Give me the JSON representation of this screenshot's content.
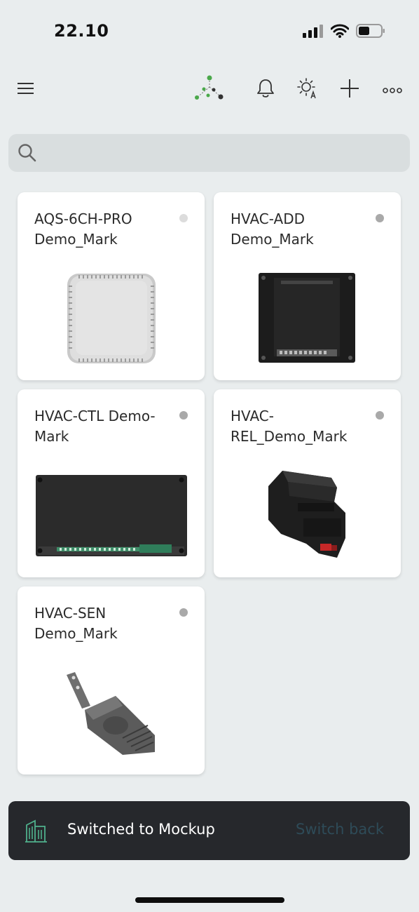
{
  "status_bar": {
    "time": "22.10"
  },
  "toolbar": {
    "icons": [
      "menu-icon",
      "logo-icon",
      "bell-icon",
      "brightness-icon",
      "plus-icon",
      "more-icon"
    ]
  },
  "search": {
    "placeholder": "",
    "value": ""
  },
  "devices": [
    {
      "name": "AQS-6CH-PRO Demo_Mark",
      "status_color": "#d9d9d9",
      "image": "air-quality-sensor"
    },
    {
      "name": "HVAC-ADD Demo_Mark",
      "status_color": "#a9a9a9",
      "image": "din-rail-module-black"
    },
    {
      "name": "HVAC-CTL Demo-Mark",
      "status_color": "#a9a9a9",
      "image": "controller-board"
    },
    {
      "name": "HVAC-REL_Demo_Mark",
      "status_color": "#a9a9a9",
      "image": "din-relay"
    },
    {
      "name": "HVAC-SEN Demo_Mark",
      "status_color": "#a9a9a9",
      "image": "temperature-sensor"
    }
  ],
  "toast": {
    "message": "Switched to Mockup",
    "action": "Switch back"
  },
  "colors": {
    "background": "#e9edee",
    "accent_green": "#4aa84a",
    "toast_bg": "#26282c"
  }
}
